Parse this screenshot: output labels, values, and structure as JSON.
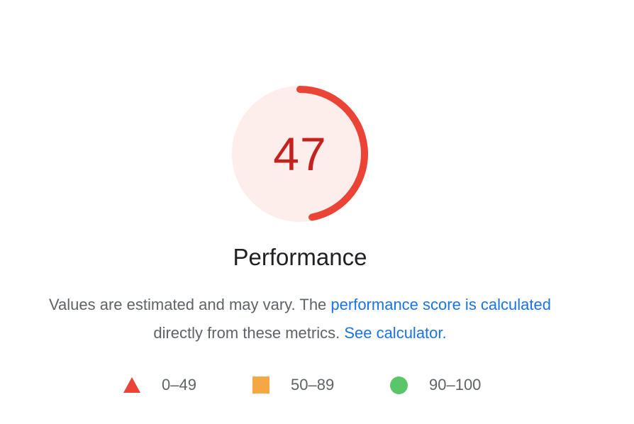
{
  "score": {
    "value": "47",
    "fraction": 0.47,
    "color": "#eb4335",
    "track_fill": "#fdeeec",
    "text_color": "#c5221f"
  },
  "category": {
    "title": "Performance"
  },
  "description": {
    "text_before": "Values are estimated and may vary. The ",
    "link_score": "performance score is calculated",
    "text_middle": "directly from these metrics. ",
    "link_calculator": "See calculator."
  },
  "legend": [
    {
      "label": "0–49",
      "icon": "fail-triangle-icon",
      "color": "#eb4335"
    },
    {
      "label": "50–89",
      "icon": "average-square-icon",
      "color": "#f4a743"
    },
    {
      "label": "90–100",
      "icon": "pass-circle-icon",
      "color": "#5ac66a"
    }
  ]
}
